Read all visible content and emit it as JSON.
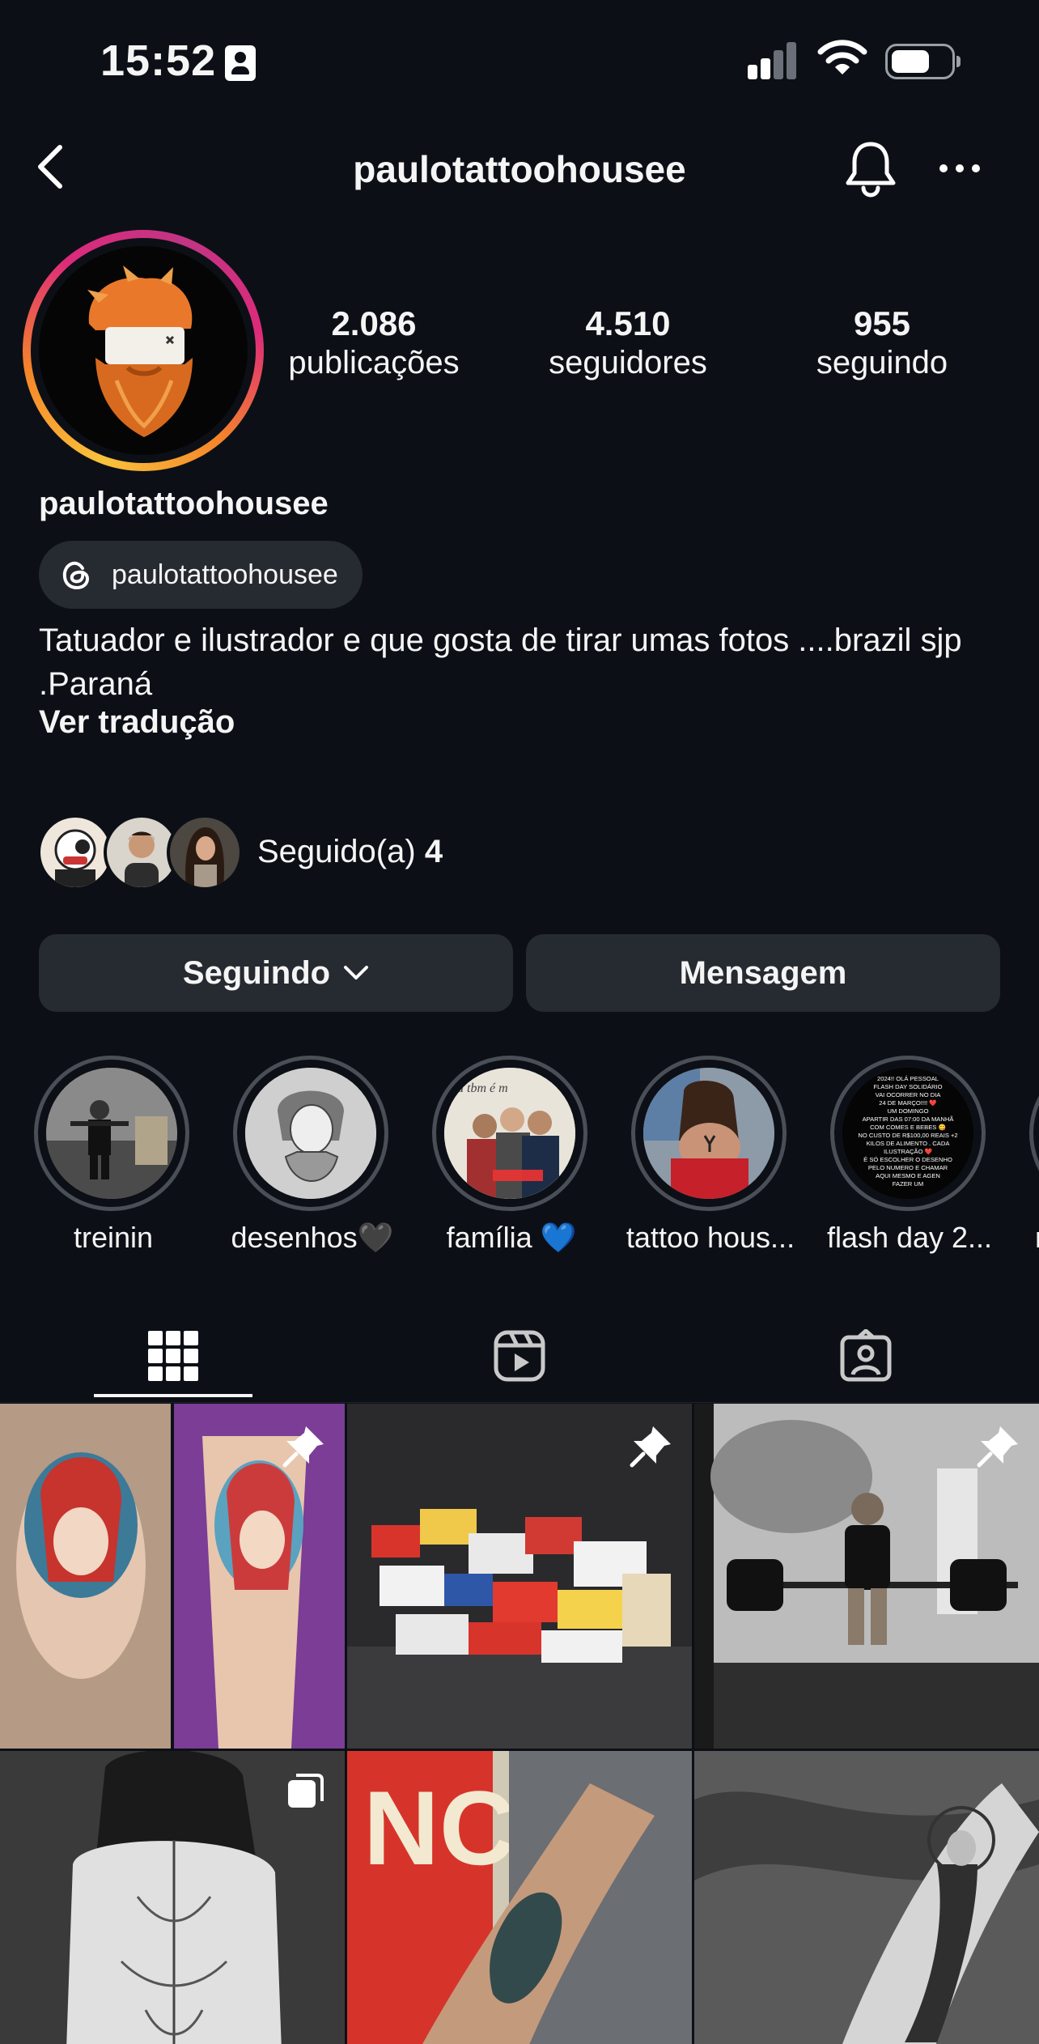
{
  "status_bar": {
    "time": "15:52"
  },
  "header": {
    "title": "paulotattoohousee"
  },
  "profile": {
    "stats": [
      {
        "value": "2.086",
        "label": "publicações"
      },
      {
        "value": "4.510",
        "label": "seguidores"
      },
      {
        "value": "955",
        "label": "seguindo"
      }
    ],
    "name": "paulotattoohousee",
    "threads_handle": "paulotattoohousee",
    "bio": "Tatuador e ilustrador e que gosta de tirar umas fotos ....brazil sjp .Paraná",
    "translate_label": "Ver tradução",
    "followed_by_text": "Seguido(a)",
    "followed_by_count": "4"
  },
  "actions": {
    "following_label": "Seguindo",
    "message_label": "Mensagem"
  },
  "highlights": [
    {
      "label": "treinin"
    },
    {
      "label": "desenhos🖤"
    },
    {
      "label": "família 💙"
    },
    {
      "label": "tattoo hous..."
    },
    {
      "label": "flash day 2..."
    },
    {
      "label": "m"
    }
  ],
  "highlight_texts": {
    "familia": "a tbm é m",
    "flash": [
      "2024!! OLÁ PESSOAL",
      "FLASH DAY SOLIDÁRIO",
      "VAI OCORRER NO DIA",
      "24 DE MARÇO!!!! ❤️",
      "UM DOMINGO",
      "APARTIR DAS 07:00 DA MANHÃ",
      "COM COMES E BEBES 😋",
      "NO CUSTO DE R$100,00 REAIS +2",
      "KILOS DE ALIMENTO . CADA",
      "ILUSTRAÇÃO ❤️",
      "É SÓ ESCOLHER O DESENHO",
      "PELO NUMERO E CHAMAR",
      "AQUI MESMO E AGEN",
      "FAZER UM"
    ]
  },
  "tabs": [
    {
      "name": "grid",
      "icon": "grid-icon"
    },
    {
      "name": "reels",
      "icon": "reels-icon"
    },
    {
      "name": "tagged",
      "icon": "tagged-icon"
    }
  ],
  "grid_posts": [
    {
      "desc": "ariel-tattoo",
      "pinned": true
    },
    {
      "desc": "food-donations",
      "pinned": true
    },
    {
      "desc": "gym-deadlift",
      "pinned": true
    },
    {
      "desc": "back-tattoo",
      "carousel": true
    },
    {
      "desc": "forearm-tattoo"
    },
    {
      "desc": "religious-arm-tattoo"
    }
  ],
  "colors": {
    "background": "#0c1016",
    "button": "#262a31",
    "text": "#f5f5f5",
    "story_ring": [
      "#f9c33c",
      "#f58529",
      "#dd2a7b",
      "#c13584"
    ]
  }
}
